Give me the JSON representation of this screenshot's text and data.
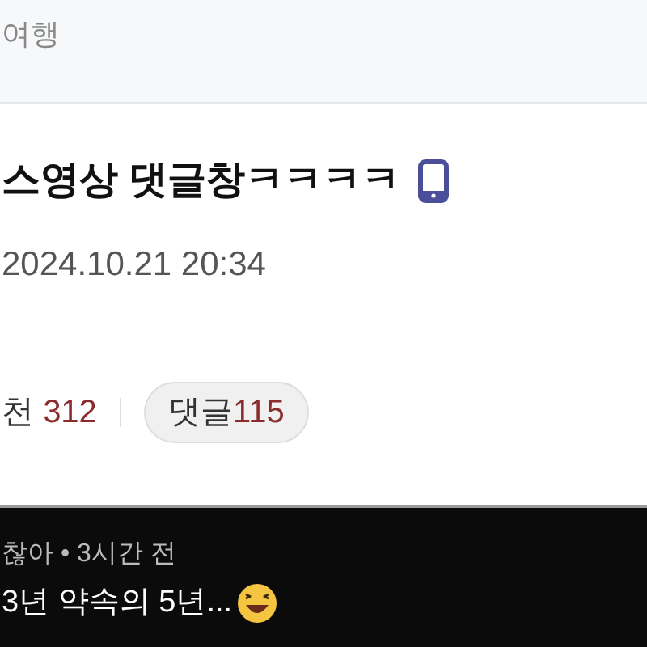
{
  "category": "여행",
  "post": {
    "title": "스영상 댓글창ㅋㅋㅋㅋ",
    "mobile": true,
    "date": "2024.10.21 20:34"
  },
  "stats": {
    "views_label": "천",
    "views": "312",
    "comments_label": "댓글",
    "comments": "115"
  },
  "embedded_comment": {
    "meta": "찮아 • 3시간 전",
    "text": "3년 약속의 5년..."
  }
}
